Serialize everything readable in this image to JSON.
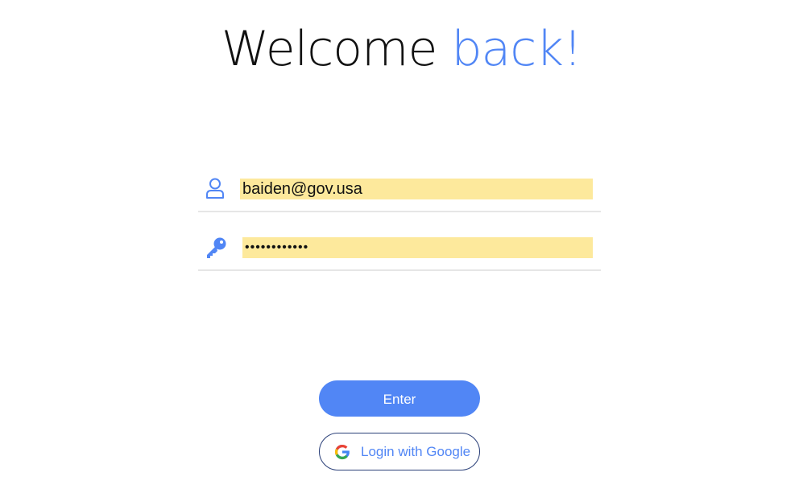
{
  "title": {
    "part1": "Welcome ",
    "part2": "back!"
  },
  "colors": {
    "accent": "#5186f5",
    "autofill": "#fde99c",
    "google_border": "#2a3f78"
  },
  "form": {
    "email": {
      "icon": "user-icon",
      "value": "baiden@gov.usa"
    },
    "password": {
      "icon": "key-icon",
      "value": "••••••••••••"
    }
  },
  "buttons": {
    "enter_label": "Enter",
    "google_label": "Login with Google",
    "google_icon": "google-logo-icon"
  }
}
